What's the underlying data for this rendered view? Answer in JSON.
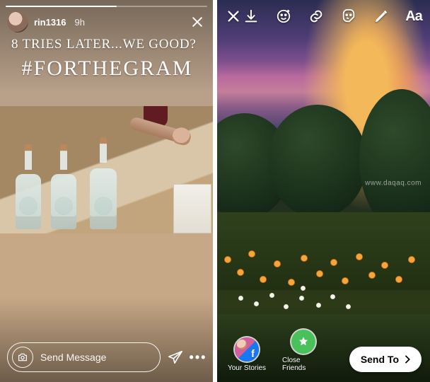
{
  "leftStory": {
    "username": "rin1316",
    "timestamp": "9h",
    "overlayLine1": "8 tries later...we good?",
    "overlayLine2": "#FORTHEGRAM",
    "messagePlaceholder": "Send Message",
    "icons": {
      "close": "close-icon",
      "camera": "camera-icon",
      "directSend": "direct-send-icon",
      "more": "more-options-icon"
    }
  },
  "rightEditor": {
    "toolbar": {
      "close": "close-icon",
      "save": "save-download-icon",
      "face": "face-filter-icon",
      "link": "link-icon",
      "sticker": "sticker-icon",
      "draw": "draw-icon",
      "text": "Aa"
    },
    "shareOptions": [
      {
        "id": "your-stories",
        "label": "Your Stories"
      },
      {
        "id": "close-friends",
        "label": "Close Friends"
      }
    ],
    "sendTo": "Send To"
  },
  "watermark": "www.daqaq.com"
}
